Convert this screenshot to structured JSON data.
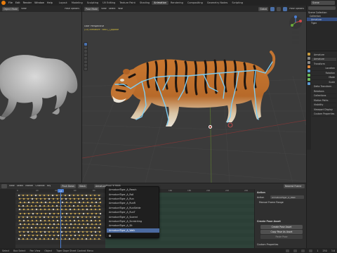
{
  "topbar": {
    "menus": [
      "File",
      "Edit",
      "Render",
      "Window",
      "Help"
    ],
    "workspaces": [
      "Layout",
      "Modeling",
      "Sculpting",
      "UV Editing",
      "Texture Paint",
      "Shading",
      "Animation",
      "Rendering",
      "Compositing",
      "Geometry Nodes",
      "Scripting"
    ],
    "active_workspace": "Animation",
    "scene_label": "Scene"
  },
  "left_viewport": {
    "mode": "Object Mode",
    "view_menu": "View",
    "options": "Pose Options"
  },
  "main_viewport": {
    "header_items": [
      "Pose Mode",
      "View",
      "Select",
      "Pose",
      "Global",
      "Pose Options"
    ],
    "view_label": "User Perspective",
    "object_label": "(13) Armature : ball1_l_pppose",
    "accent_yellow": "#d9c23c",
    "bone_color": "#7fcdf2"
  },
  "outliner": {
    "rows": [
      {
        "label": "Scene Collection",
        "selected": false
      },
      {
        "label": "Collection",
        "selected": false
      },
      {
        "label": "Armature",
        "selected": true
      },
      {
        "label": "Tiger",
        "selected": false
      }
    ]
  },
  "properties": {
    "object_name": "Armature",
    "sub_name": "Armature",
    "sections": [
      "Transform",
      "Location",
      "Rotation",
      "Mode",
      "Scale",
      "Delta Transform",
      "Relations",
      "Collections",
      "Motion Paths",
      "Visibility",
      "Viewport Display",
      "Custom Properties"
    ]
  },
  "dopesheet": {
    "header_items": [
      "View",
      "Select",
      "Marker",
      "Channel",
      "Key",
      "Push Down",
      "Stash"
    ],
    "action_field": "ArmatureTiger_A_Walk",
    "keying": "Nearest Frame",
    "ruler": [
      "0",
      "20",
      "40",
      "60",
      "80",
      "100",
      "120",
      "140",
      "160",
      "180",
      "200",
      "220",
      "240"
    ]
  },
  "action_dropdown": {
    "items": [
      "ArmatureTiger_A_Reach",
      "ArmatureTiger_A_Roll",
      "ArmatureTiger_A_Run",
      "ArmatureTiger_A_RunR",
      "ArmatureTiger_A_RunStride",
      "ArmatureTiger_A_RunT",
      "ArmatureTiger_A_Scared",
      "ArmatureTiger_A_Scratching",
      "ArmatureTiger_A_Sit",
      "ArmatureTiger_A_Walk"
    ],
    "selected_index": 9,
    "search_placeholder": ""
  },
  "action_panel": {
    "section_action": "Action",
    "action_label": "Action",
    "action_value": "ArmatureTiger_A_Walk",
    "manual_frame_range": "Manual Frame Range",
    "section_pose_asset": "Create Pose Asset",
    "create_pose_asset": "Create Pose Asset",
    "copy_pose_as_asset": "Copy Pose As Asset",
    "paste_pose": "Paste Pose",
    "section_custom": "Custom Properties"
  },
  "statusbar": {
    "items": [
      "Select",
      "Box Select",
      "Pan View",
      "Object",
      "Tiger Dope Sheet Context Menu"
    ],
    "frame": "13",
    "start": "1",
    "end": "250",
    "version": "3.6"
  }
}
